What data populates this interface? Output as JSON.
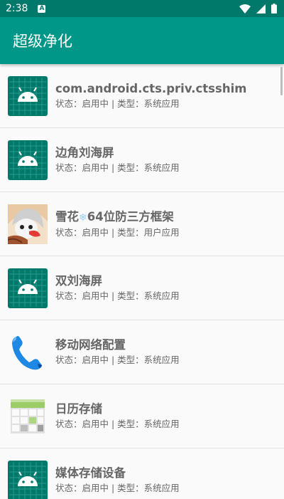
{
  "status_bar": {
    "time": "2:38",
    "notification_icon": "A"
  },
  "app_bar": {
    "title": "超级净化"
  },
  "apps": [
    {
      "name": "com.android.cts.priv.ctsshim",
      "status": "状态：启用中 | 类型：系统应用",
      "icon": "android-icon"
    },
    {
      "name": "边角刘海屏",
      "status": "状态：启用中 | 类型：系统应用",
      "icon": "android-icon"
    },
    {
      "name_before": "雪花",
      "name_emoji": "❄",
      "name_after": "64位防三方框架",
      "status": "状态：启用中 | 类型：用户应用",
      "icon": "avatar-icon"
    },
    {
      "name": "双刘海屏",
      "status": "状态：启用中 | 类型：系统应用",
      "icon": "android-icon"
    },
    {
      "name": "移动网络配置",
      "status": "状态：启用中 | 类型：系统应用",
      "icon": "phone-icon"
    },
    {
      "name": "日历存储",
      "status": "状态：启用中 | 类型：系统应用",
      "icon": "calendar-storage-icon"
    },
    {
      "name": "媒体存储设备",
      "status": "状态：启用中 | 类型：系统应用",
      "icon": "android-icon"
    }
  ],
  "colors": {
    "status_bar": "#00796b",
    "app_bar": "#009688",
    "android_icon_bg": "#00796b"
  }
}
